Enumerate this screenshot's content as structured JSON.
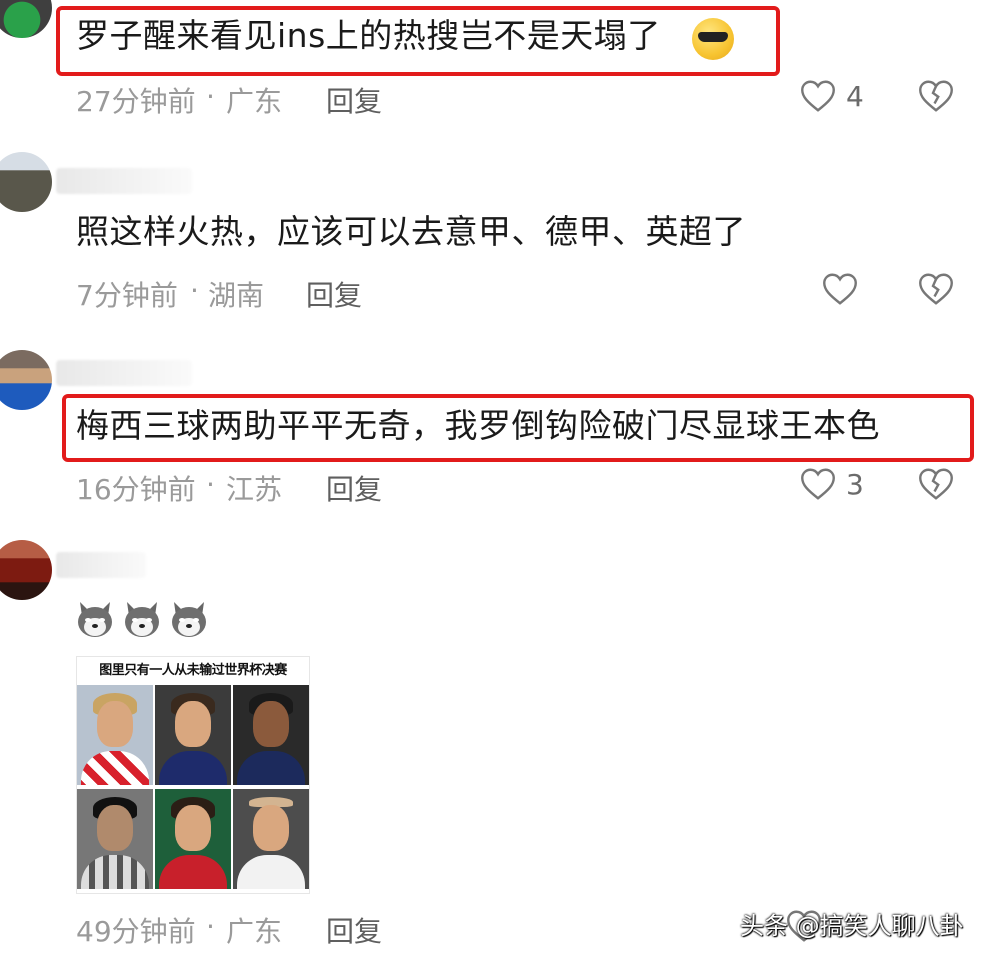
{
  "comments": [
    {
      "text": "罗子醒来看见ins上的热搜岂不是天塌了",
      "emoji": "sunglasses-tears-emoji",
      "time": "27分钟前",
      "location": "广东",
      "reply": "回复",
      "likes": "4",
      "highlighted": true
    },
    {
      "text": "照这样火热，应该可以去意甲、德甲、英超了",
      "time": "7分钟前",
      "location": "湖南",
      "reply": "回复",
      "likes": "",
      "highlighted": false
    },
    {
      "text": "梅西三球两助平平无奇，我罗倒钩险破门尽显球王本色",
      "time": "16分钟前",
      "location": "江苏",
      "reply": "回复",
      "likes": "3",
      "highlighted": true
    },
    {
      "text": "",
      "emojis": [
        "husky-emoji",
        "husky-emoji",
        "husky-emoji"
      ],
      "image_title": "图里只有一人从未输过世界杯决赛",
      "time": "49分钟前",
      "location": "广东",
      "reply": "回复",
      "likes": ""
    }
  ],
  "separator": "·",
  "watermark": "头条 @搞笑人聊八卦",
  "colors": {
    "highlight": "#e21b1b",
    "meta": "#9a9a9a",
    "icon": "#777777"
  }
}
